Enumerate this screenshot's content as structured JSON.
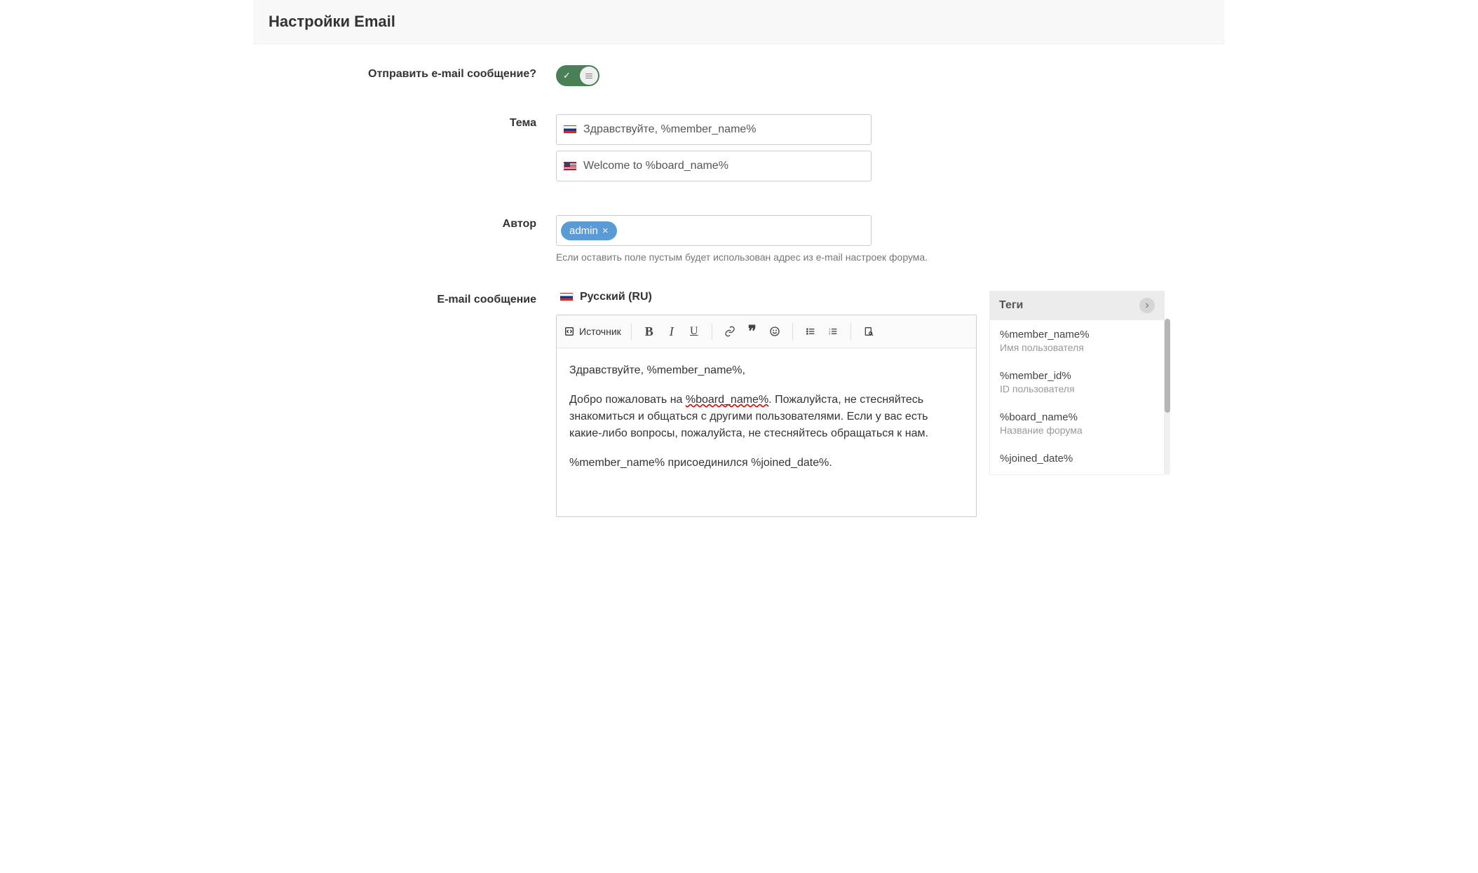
{
  "header": {
    "title": "Настройки Email"
  },
  "send_email": {
    "label": "Отправить e-mail сообщение?",
    "enabled": true
  },
  "subject": {
    "label": "Тема",
    "ru_value": "Здравствуйте, %member_name%",
    "en_value": "Welcome to %board_name%"
  },
  "author": {
    "label": "Автор",
    "chip_text": "admin",
    "chip_remove": "×",
    "help": "Если оставить поле пустым будет использован адрес из e-mail настроек форума."
  },
  "message": {
    "label": "E-mail сообщение",
    "lang_label": "Русский (RU)",
    "toolbar": {
      "source": "Источник"
    },
    "body": {
      "greeting": "Здравствуйте, %member_name%,",
      "para_pre": "Добро пожаловать на ",
      "para_mid": "%board_name%",
      "para_post": ". Пожалуйста, не стесняйтесь знакомиться и общаться с другими пользователями. Если у вас есть какие-либо вопросы, пожалуйста, не стесняйтесь обращаться к нам.",
      "joined": "%member_name% присоединился %joined_date%."
    }
  },
  "tags": {
    "header": "Теги",
    "items": [
      {
        "key": "%member_name%",
        "desc": "Имя пользователя"
      },
      {
        "key": "%member_id%",
        "desc": "ID пользователя"
      },
      {
        "key": "%board_name%",
        "desc": "Название форума"
      },
      {
        "key": "%joined_date%",
        "desc": ""
      }
    ]
  }
}
